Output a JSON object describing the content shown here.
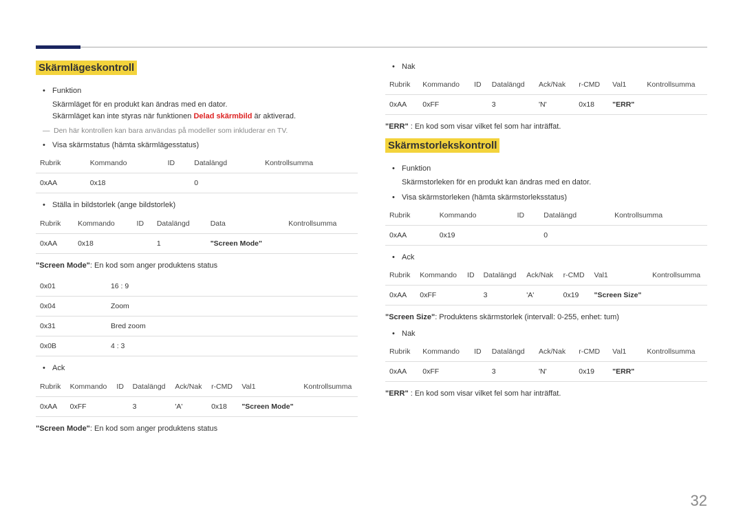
{
  "left": {
    "heading": "Skärmlägeskontroll",
    "b_funktion": "Funktion",
    "funktion_l1": "Skärmläget för en produkt kan ändras med en dator.",
    "funktion_l2a": "Skärmläget kan inte styras när funktionen ",
    "funktion_l2_red": "Delad skärmbild",
    "funktion_l2b": " är aktiverad.",
    "note": "Den här kontrollen kan bara användas på modeller som inkluderar en TV.",
    "b_visa": "Visa skärmstatus (hämta skärmlägesstatus)",
    "t1h": [
      "Rubrik",
      "Kommando",
      "ID",
      "Datalängd",
      "Kontrollsumma"
    ],
    "t1r": [
      "0xAA",
      "0x18",
      "",
      "0",
      ""
    ],
    "b_stall": "Ställa in bildstorlek (ange bildstorlek)",
    "t2h": [
      "Rubrik",
      "Kommando",
      "ID",
      "Datalängd",
      "Data",
      "Kontrollsumma"
    ],
    "t2r": [
      "0xAA",
      "0x18",
      "",
      "1",
      "\"Screen Mode\"",
      ""
    ],
    "screenmode_label": "\"Screen Mode\"",
    "screenmode_desc": ": En kod som anger produktens status",
    "modes": [
      [
        "0x01",
        "16 : 9"
      ],
      [
        "0x04",
        "Zoom"
      ],
      [
        "0x31",
        "Bred zoom"
      ],
      [
        "0x0B",
        "4 : 3"
      ]
    ],
    "b_ack": "Ack",
    "t3h": [
      "Rubrik",
      "Kommando",
      "ID",
      "Datalängd",
      "Ack/Nak",
      "r-CMD",
      "Val1",
      "Kontrollsumma"
    ],
    "t3r": [
      "0xAA",
      "0xFF",
      "",
      "3",
      "'A'",
      "0x18",
      "\"Screen Mode\"",
      ""
    ],
    "screenmode2_label": "\"Screen Mode\"",
    "screenmode2_desc": ": En kod som anger produktens status"
  },
  "right": {
    "b_nak": "Nak",
    "t4h": [
      "Rubrik",
      "Kommando",
      "ID",
      "Datalängd",
      "Ack/Nak",
      "r-CMD",
      "Val1",
      "Kontrollsumma"
    ],
    "t4r": [
      "0xAA",
      "0xFF",
      "",
      "3",
      "'N'",
      "0x18",
      "\"ERR\"",
      ""
    ],
    "err_label": "\"ERR\"",
    "err_desc": " : En kod som visar vilket fel som har inträffat.",
    "heading2": "Skärmstorlekskontroll",
    "b_funktion2": "Funktion",
    "funktion2_l1": "Skärmstorleken för en produkt kan ändras med en dator.",
    "b_visa2": "Visa skärmstorleken (hämta skärmstorleksstatus)",
    "t5h": [
      "Rubrik",
      "Kommando",
      "ID",
      "Datalängd",
      "Kontrollsumma"
    ],
    "t5r": [
      "0xAA",
      "0x19",
      "",
      "0",
      ""
    ],
    "b_ack2": "Ack",
    "t6h": [
      "Rubrik",
      "Kommando",
      "ID",
      "Datalängd",
      "Ack/Nak",
      "r-CMD",
      "Val1",
      "Kontrollsumma"
    ],
    "t6r": [
      "0xAA",
      "0xFF",
      "",
      "3",
      "'A'",
      "0x19",
      "\"Screen Size\"",
      ""
    ],
    "size_label": "\"Screen Size\"",
    "size_desc": ": Produktens skärmstorlek (intervall: 0-255, enhet: tum)",
    "b_nak2": "Nak",
    "t7h": [
      "Rubrik",
      "Kommando",
      "ID",
      "Datalängd",
      "Ack/Nak",
      "r-CMD",
      "Val1",
      "Kontrollsumma"
    ],
    "t7r": [
      "0xAA",
      "0xFF",
      "",
      "3",
      "'N'",
      "0x19",
      "\"ERR\"",
      ""
    ],
    "err2_label": "\"ERR\"",
    "err2_desc": " : En kod som visar vilket fel som har inträffat."
  },
  "page": "32"
}
